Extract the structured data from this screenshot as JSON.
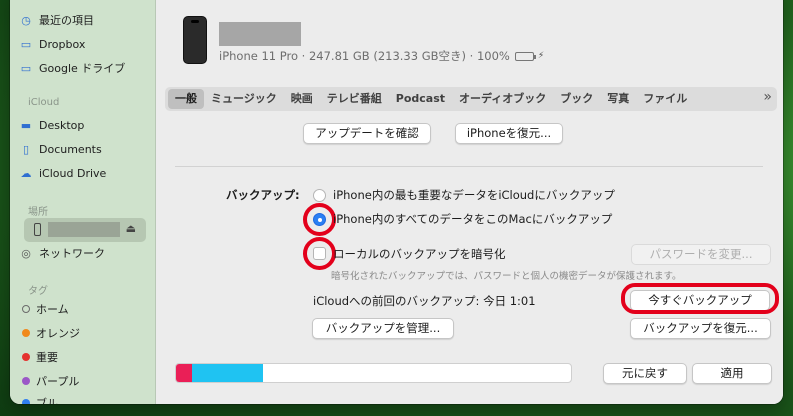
{
  "sidebar": {
    "favorites": [
      {
        "label": "最近の項目",
        "icon": "clock-icon"
      },
      {
        "label": "Dropbox",
        "icon": "folder-icon"
      },
      {
        "label": "Google ドライブ",
        "icon": "folder-icon"
      }
    ],
    "icloud_header": "iCloud",
    "icloud": [
      {
        "label": "Desktop",
        "icon": "desktop-icon"
      },
      {
        "label": "Documents",
        "icon": "document-icon"
      },
      {
        "label": "iCloud Drive",
        "icon": "cloud-icon"
      }
    ],
    "locations_header": "場所",
    "network_label": "ネットワーク",
    "tags_header": "タグ",
    "tags": [
      {
        "label": "ホーム",
        "color": "hollow"
      },
      {
        "label": "オレンジ",
        "color": "#f0891b"
      },
      {
        "label": "重要",
        "color": "#e4332f"
      },
      {
        "label": "パープル",
        "color": "#9b57c7"
      },
      {
        "label": "ブル",
        "color": "#2f7ef0"
      }
    ]
  },
  "device": {
    "model": "iPhone 11 Pro",
    "capacity": "247.81 GB",
    "free": "(213.33 GB空き)",
    "battery": "100%"
  },
  "tabs": [
    "一般",
    "ミュージック",
    "映画",
    "テレビ番組",
    "Podcast",
    "オーディオブック",
    "ブック",
    "写真",
    "ファイル"
  ],
  "active_tab": "一般",
  "software": {
    "check_update": "アップデートを確認",
    "restore_iphone": "iPhoneを復元..."
  },
  "backups": {
    "heading": "バックアップ:",
    "option_icloud": "iPhone内の最も重要なデータをiCloudにバックアップ",
    "option_mac": "iPhone内のすべてのデータをこのMacにバックアップ",
    "selected": "mac",
    "encrypt_label": "ローカルのバックアップを暗号化",
    "encrypt_checked": false,
    "change_password": "パスワードを変更...",
    "encrypt_note": "暗号化されたバックアップでは、パスワードと個人の機密データが保護されます。",
    "last_backup": "iCloudへの前回のバックアップ: 今日 1:01",
    "backup_now": "今すぐバックアップ",
    "manage": "バックアップを管理...",
    "restore_backup": "バックアップを復元..."
  },
  "storage": {
    "segments": [
      {
        "fraction": 0.04,
        "color": "#ea1f57"
      },
      {
        "fraction": 0.18,
        "color": "#1fc3f2"
      }
    ]
  },
  "footer": {
    "revert": "元に戻す",
    "apply": "適用"
  },
  "highlight_color": "#e3001b"
}
